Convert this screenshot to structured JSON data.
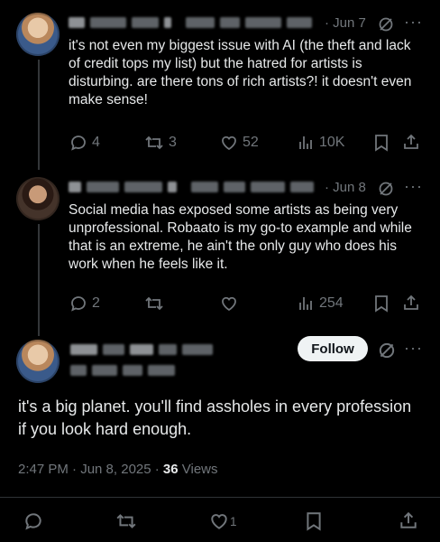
{
  "posts": [
    {
      "date": "· Jun 7",
      "text": "it's not even my biggest issue with AI (the theft and lack of credit tops my list) but the hatred for artists is disturbing. are there tons of rich artists?! it doesn't even make sense!",
      "replies": "4",
      "reposts": "3",
      "likes": "52",
      "views": "10K"
    },
    {
      "date": "· Jun 8",
      "text": "Social media has exposed some artists as being very unprofessional. Robaato is my go-to example and while that is an extreme, he ain't the only guy who does his work when he feels like it.",
      "replies": "2",
      "reposts": "",
      "likes": "",
      "views": "254"
    }
  ],
  "main_post": {
    "follow_label": "Follow",
    "text": "it's a big planet. you'll find assholes in every profession if you look hard enough.",
    "timestamp": "2:47 PM · Jun 8, 2025 · ",
    "views_count": "36",
    "views_label": " Views",
    "likes": "1"
  },
  "icons": [
    "reply-icon",
    "repost-icon",
    "like-icon",
    "views-icon",
    "bookmark-icon",
    "share-icon",
    "grok-icon",
    "more-icon"
  ]
}
